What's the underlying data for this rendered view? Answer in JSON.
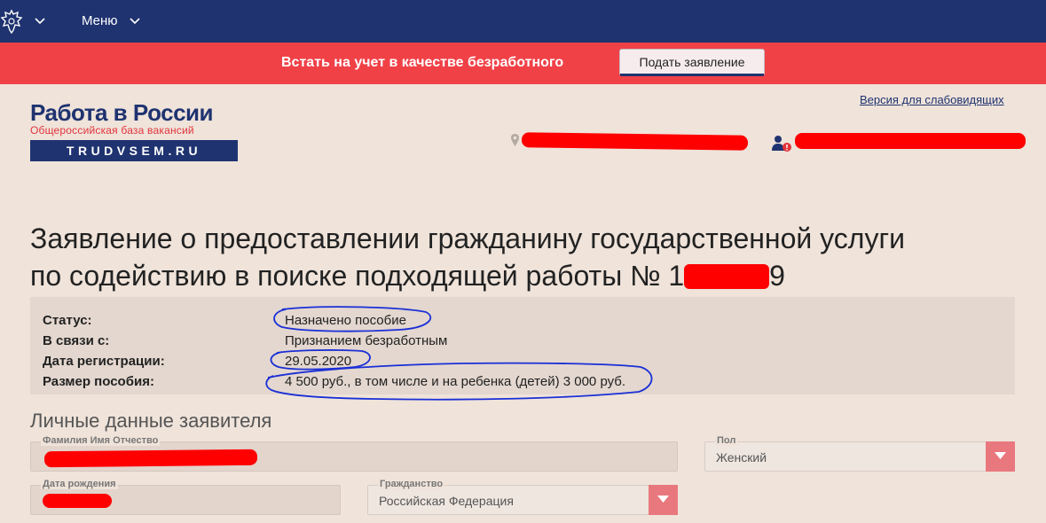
{
  "topbar": {
    "menu_label": "Меню"
  },
  "banner": {
    "text": "Встать на учет в качестве безработного",
    "button_label": "Подать заявление"
  },
  "logo": {
    "title": "Работа в России",
    "subtitle": "Общероссийская база вакансий",
    "domain": "TRUDVSEM.RU"
  },
  "header": {
    "accessibility_link": "Версия для слабовидящих"
  },
  "page": {
    "title_line1": "Заявление о предоставлении гражданину государственной услуги",
    "title_line2_prefix": "по содействию в поиске подходящей работы № 1",
    "title_line2_suffix": "9"
  },
  "status": [
    {
      "label": "Статус:",
      "value": "Назначено пособие"
    },
    {
      "label": "В связи с:",
      "value": "Признанием безработным"
    },
    {
      "label": "Дата регистрации:",
      "value": "29.05.2020"
    },
    {
      "label": "Размер пособия:",
      "value": "4 500 руб., в том числе и на ребенка (детей) 3 000 руб."
    }
  ],
  "personal": {
    "section_title": "Личные данные заявителя",
    "fio_label": "Фамилия Имя Отчество",
    "gender_label": "Пол",
    "gender_value": "Женский",
    "birth_label": "Дата рождения",
    "citizenship_label": "Гражданство",
    "citizenship_value": "Российская Федерация"
  },
  "colors": {
    "navy": "#1f3370",
    "banner_red": "#f04147",
    "page_bg": "#efe3da",
    "redaction": "#ff0000",
    "annotation": "#1a2fd6"
  },
  "icons": [
    "russia-emblem-icon",
    "chevron-down-icon",
    "map-pin-icon",
    "user-alert-icon",
    "select-arrow-icon"
  ]
}
